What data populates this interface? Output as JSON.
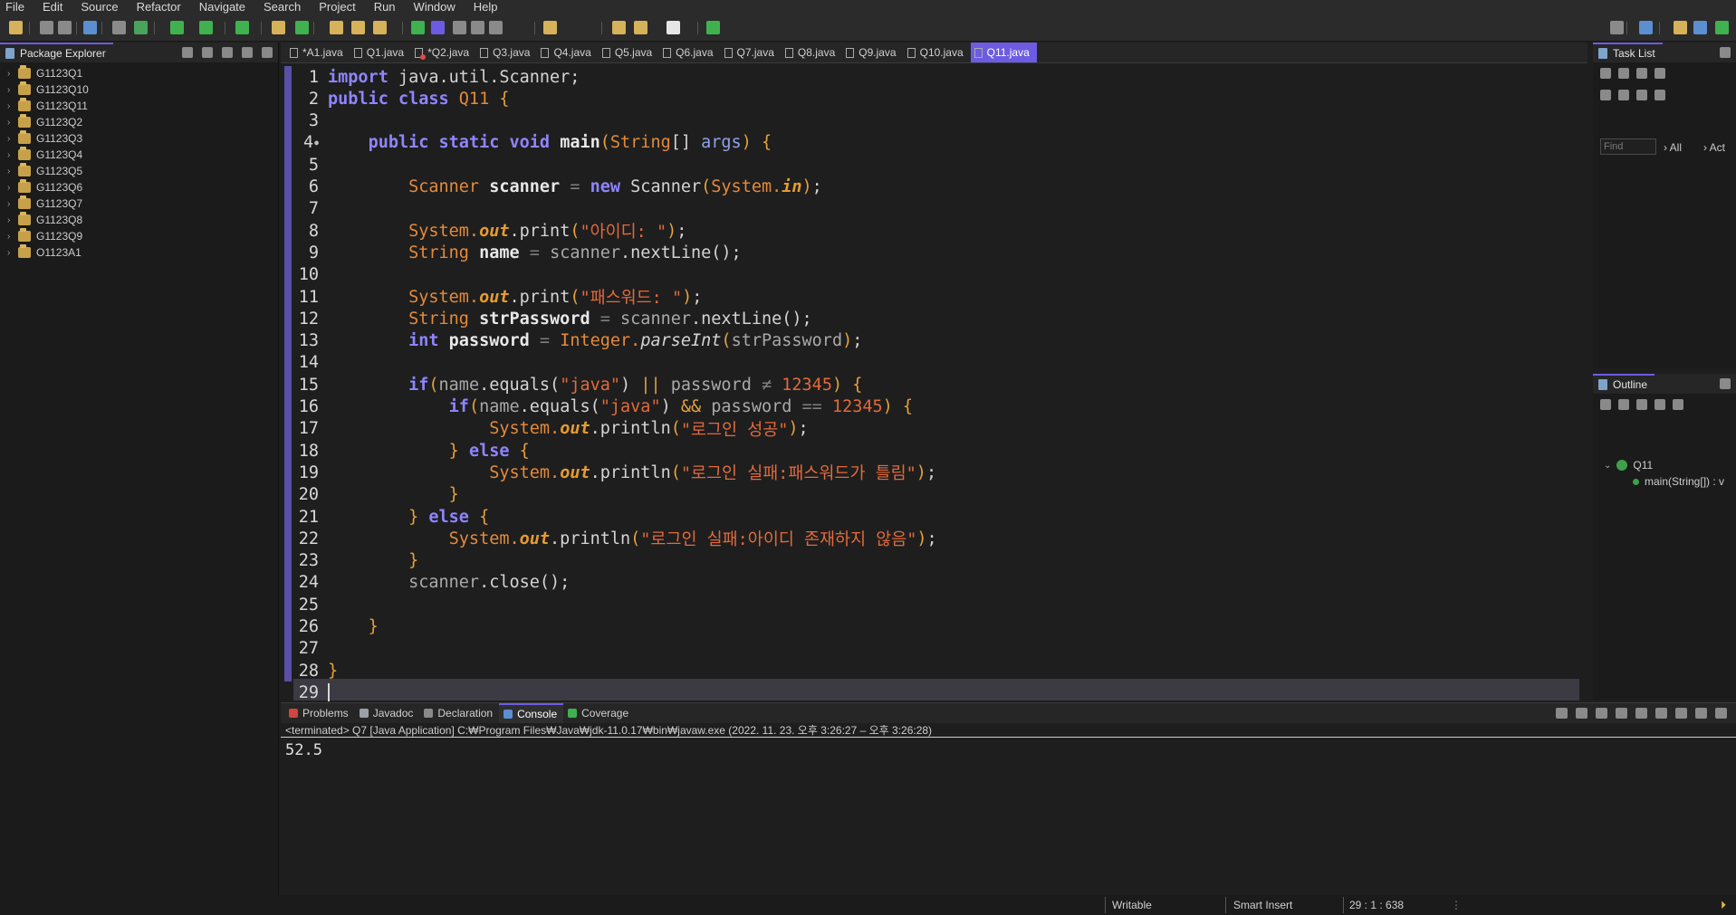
{
  "menu": [
    "File",
    "Edit",
    "Source",
    "Refactor",
    "Navigate",
    "Search",
    "Project",
    "Run",
    "Window",
    "Help"
  ],
  "package_explorer": {
    "title": "Package Explorer",
    "projects": [
      "G1123Q1",
      "G1123Q10",
      "G1123Q11",
      "G1123Q2",
      "G1123Q3",
      "G1123Q4",
      "G1123Q5",
      "G1123Q6",
      "G1123Q7",
      "G1123Q8",
      "G1123Q9",
      "O1123A1"
    ]
  },
  "editor": {
    "tabs": [
      {
        "label": "*A1.java",
        "error": false
      },
      {
        "label": "Q1.java",
        "error": false
      },
      {
        "label": "*Q2.java",
        "error": true
      },
      {
        "label": "Q3.java",
        "error": false
      },
      {
        "label": "Q4.java",
        "error": false
      },
      {
        "label": "Q5.java",
        "error": false
      },
      {
        "label": "Q6.java",
        "error": false
      },
      {
        "label": "Q7.java",
        "error": false
      },
      {
        "label": "Q8.java",
        "error": false
      },
      {
        "label": "Q9.java",
        "error": false
      },
      {
        "label": "Q10.java",
        "error": false
      },
      {
        "label": "Q11.java",
        "error": false,
        "active": true
      }
    ],
    "lines": [
      {
        "n": "1",
        "code": [
          [
            "kw",
            "import"
          ],
          [
            "plain",
            " java.util.Scanner;"
          ]
        ]
      },
      {
        "n": "2",
        "code": [
          [
            "kw",
            "public class"
          ],
          [
            "type",
            " Q11 "
          ],
          [
            "brace",
            "{"
          ]
        ]
      },
      {
        "n": "3",
        "code": []
      },
      {
        "n": "4",
        "fold": true,
        "code": [
          [
            "plain",
            "    "
          ],
          [
            "kw",
            "public static void"
          ],
          [
            "plain",
            " "
          ],
          [
            "var",
            "main"
          ],
          [
            "brace",
            "("
          ],
          [
            "type",
            "String"
          ],
          [
            "plain",
            "[] "
          ],
          [
            "kw2",
            "args"
          ],
          [
            "brace",
            ") {"
          ]
        ]
      },
      {
        "n": "5",
        "code": []
      },
      {
        "n": "6",
        "code": [
          [
            "plain",
            "        "
          ],
          [
            "type",
            "Scanner"
          ],
          [
            "plain",
            " "
          ],
          [
            "var",
            "scanner"
          ],
          [
            "op",
            " = "
          ],
          [
            "kw",
            "new"
          ],
          [
            "plain",
            " Scanner"
          ],
          [
            "brace",
            "("
          ],
          [
            "type",
            "System."
          ],
          [
            "field",
            "in"
          ],
          [
            "brace",
            ")"
          ],
          [
            "plain",
            ";"
          ]
        ]
      },
      {
        "n": "7",
        "code": []
      },
      {
        "n": "8",
        "code": [
          [
            "plain",
            "        "
          ],
          [
            "type",
            "System."
          ],
          [
            "field",
            "out"
          ],
          [
            "plain",
            ".print"
          ],
          [
            "brace",
            "("
          ],
          [
            "str",
            "\"아이디: \""
          ],
          [
            "brace",
            ")"
          ],
          [
            "plain",
            ";"
          ]
        ]
      },
      {
        "n": "9",
        "code": [
          [
            "plain",
            "        "
          ],
          [
            "type",
            "String"
          ],
          [
            "plain",
            " "
          ],
          [
            "var",
            "name"
          ],
          [
            "op",
            " = "
          ],
          [
            "dim",
            "scanner"
          ],
          [
            "plain",
            ".nextLine();"
          ]
        ]
      },
      {
        "n": "10",
        "code": []
      },
      {
        "n": "11",
        "code": [
          [
            "plain",
            "        "
          ],
          [
            "type",
            "System."
          ],
          [
            "field",
            "out"
          ],
          [
            "plain",
            ".print"
          ],
          [
            "brace",
            "("
          ],
          [
            "str",
            "\"패스워드: \""
          ],
          [
            "brace",
            ")"
          ],
          [
            "plain",
            ";"
          ]
        ]
      },
      {
        "n": "12",
        "code": [
          [
            "plain",
            "        "
          ],
          [
            "type",
            "String"
          ],
          [
            "plain",
            " "
          ],
          [
            "var",
            "strPassword"
          ],
          [
            "op",
            " = "
          ],
          [
            "dim",
            "scanner"
          ],
          [
            "plain",
            ".nextLine();"
          ]
        ]
      },
      {
        "n": "13",
        "code": [
          [
            "plain",
            "        "
          ],
          [
            "kw",
            "int"
          ],
          [
            "plain",
            " "
          ],
          [
            "var",
            "password"
          ],
          [
            "op",
            " = "
          ],
          [
            "type",
            "Integer."
          ],
          [
            "static",
            "parseInt"
          ],
          [
            "brace",
            "("
          ],
          [
            "dim",
            "strPassword"
          ],
          [
            "brace",
            ")"
          ],
          [
            "plain",
            ";"
          ]
        ]
      },
      {
        "n": "14",
        "code": []
      },
      {
        "n": "15",
        "code": [
          [
            "plain",
            "        "
          ],
          [
            "kw",
            "if"
          ],
          [
            "brace",
            "("
          ],
          [
            "dim",
            "name"
          ],
          [
            "plain",
            ".equals("
          ],
          [
            "str",
            "\"java\""
          ],
          [
            "plain",
            ") "
          ],
          [
            "brace",
            "||"
          ],
          [
            "plain",
            " "
          ],
          [
            "dim",
            "password"
          ],
          [
            "op",
            " ≠ "
          ],
          [
            "num",
            "12345"
          ],
          [
            "brace",
            ") {"
          ]
        ]
      },
      {
        "n": "16",
        "code": [
          [
            "plain",
            "            "
          ],
          [
            "kw",
            "if"
          ],
          [
            "brace",
            "("
          ],
          [
            "dim",
            "name"
          ],
          [
            "plain",
            ".equals("
          ],
          [
            "str",
            "\"java\""
          ],
          [
            "plain",
            ") "
          ],
          [
            "brace",
            "&&"
          ],
          [
            "plain",
            " "
          ],
          [
            "dim",
            "password"
          ],
          [
            "op",
            " == "
          ],
          [
            "num",
            "12345"
          ],
          [
            "brace",
            ") {"
          ]
        ]
      },
      {
        "n": "17",
        "code": [
          [
            "plain",
            "                "
          ],
          [
            "type",
            "System."
          ],
          [
            "field",
            "out"
          ],
          [
            "plain",
            ".println"
          ],
          [
            "brace",
            "("
          ],
          [
            "str",
            "\"로그인 성공\""
          ],
          [
            "brace",
            ")"
          ],
          [
            "plain",
            ";"
          ]
        ]
      },
      {
        "n": "18",
        "code": [
          [
            "plain",
            "            "
          ],
          [
            "brace",
            "}"
          ],
          [
            "plain",
            " "
          ],
          [
            "kw",
            "else"
          ],
          [
            "plain",
            " "
          ],
          [
            "brace",
            "{"
          ]
        ]
      },
      {
        "n": "19",
        "code": [
          [
            "plain",
            "                "
          ],
          [
            "type",
            "System."
          ],
          [
            "field",
            "out"
          ],
          [
            "plain",
            ".println"
          ],
          [
            "brace",
            "("
          ],
          [
            "str",
            "\"로그인 실패:패스워드가 틀림\""
          ],
          [
            "brace",
            ")"
          ],
          [
            "plain",
            ";"
          ]
        ]
      },
      {
        "n": "20",
        "code": [
          [
            "plain",
            "            "
          ],
          [
            "brace",
            "}"
          ]
        ]
      },
      {
        "n": "21",
        "code": [
          [
            "plain",
            "        "
          ],
          [
            "brace",
            "}"
          ],
          [
            "plain",
            " "
          ],
          [
            "kw",
            "else"
          ],
          [
            "plain",
            " "
          ],
          [
            "brace",
            "{"
          ]
        ]
      },
      {
        "n": "22",
        "code": [
          [
            "plain",
            "            "
          ],
          [
            "type",
            "System."
          ],
          [
            "field",
            "out"
          ],
          [
            "plain",
            ".println"
          ],
          [
            "brace",
            "("
          ],
          [
            "str",
            "\"로그인 실패:아이디 존재하지 않음\""
          ],
          [
            "brace",
            ")"
          ],
          [
            "plain",
            ";"
          ]
        ]
      },
      {
        "n": "23",
        "code": [
          [
            "plain",
            "        "
          ],
          [
            "brace",
            "}"
          ]
        ]
      },
      {
        "n": "24",
        "code": [
          [
            "plain",
            "        "
          ],
          [
            "dim",
            "scanner"
          ],
          [
            "plain",
            ".close();"
          ]
        ]
      },
      {
        "n": "25",
        "code": []
      },
      {
        "n": "26",
        "code": [
          [
            "plain",
            "    "
          ],
          [
            "brace",
            "}"
          ]
        ]
      },
      {
        "n": "27",
        "code": []
      },
      {
        "n": "28",
        "code": [
          [
            "brace",
            "}"
          ]
        ]
      },
      {
        "n": "29",
        "code": [],
        "cursor": true
      }
    ]
  },
  "task_list": {
    "title": "Task List",
    "find_placeholder": "Find",
    "all_label": "All",
    "act_label": "Act"
  },
  "outline": {
    "title": "Outline",
    "class_name": "Q11",
    "method": "main(String[]) : v"
  },
  "console": {
    "tabs": [
      "Problems",
      "Javadoc",
      "Declaration",
      "Console",
      "Coverage"
    ],
    "active_tab": "Console",
    "status": "<terminated> Q7 [Java Application] C:₩Program Files₩Java₩jdk-11.0.17₩bin₩javaw.exe  (2022. 11. 23. 오후 3:26:27 – 오후 3:26:28)",
    "output": "52.5"
  },
  "statusbar": {
    "writable": "Writable",
    "insert_mode": "Smart Insert",
    "position": "29 : 1 : 638"
  },
  "colors": {
    "accent": "#6d5ce3",
    "keyword": "#8f85ff",
    "type": "#e58a3b",
    "string": "#e26a3c"
  }
}
